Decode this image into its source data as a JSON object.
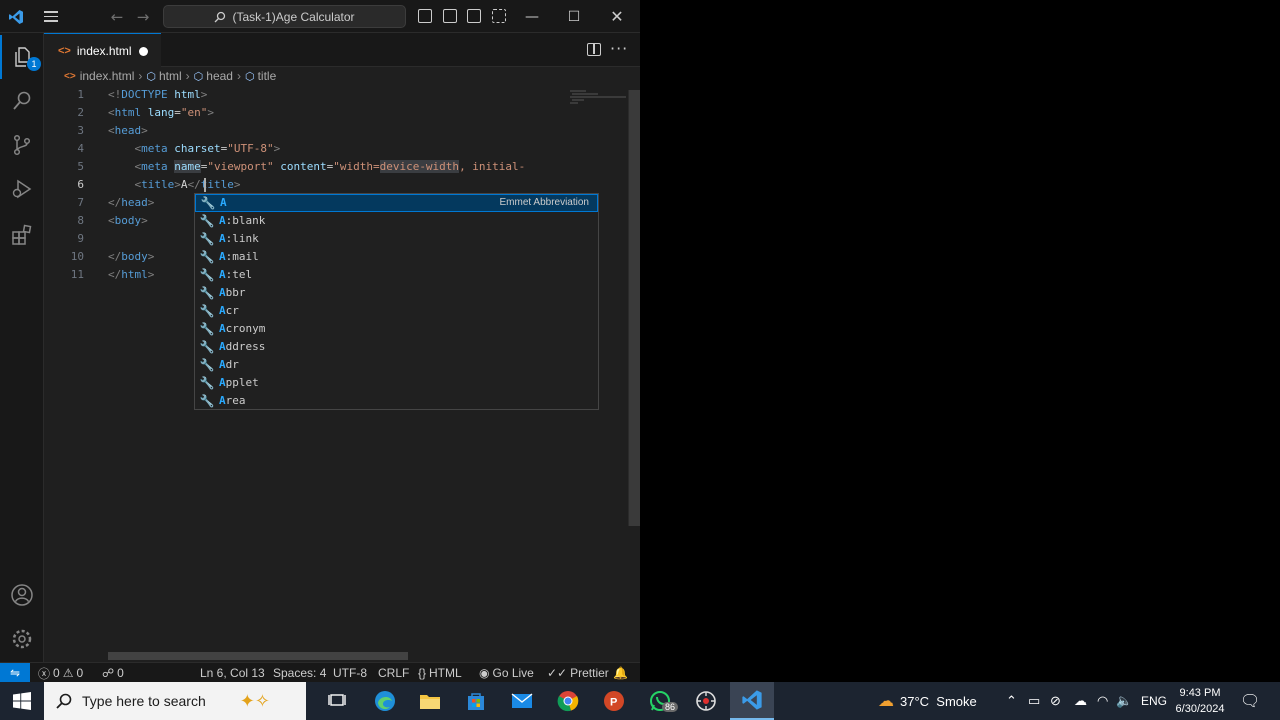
{
  "titlebar": {
    "command_center": "(Task-1)Age Calculator"
  },
  "activity": {
    "explorer_badge": "1"
  },
  "tab": {
    "label": "index.html"
  },
  "breadcrumb": {
    "items": [
      "index.html",
      "html",
      "head",
      "title"
    ]
  },
  "editor": {
    "line_numbers": [
      "1",
      "2",
      "3",
      "4",
      "5",
      "6",
      "7",
      "8",
      "9",
      "10",
      "11"
    ],
    "active_line": "6"
  },
  "suggest": {
    "detail": "Emmet Abbreviation",
    "items": [
      {
        "match": "A",
        "rest": ""
      },
      {
        "match": "A",
        "rest": ":blank"
      },
      {
        "match": "A",
        "rest": ":link"
      },
      {
        "match": "A",
        "rest": ":mail"
      },
      {
        "match": "A",
        "rest": ":tel"
      },
      {
        "match": "A",
        "rest": "bbr"
      },
      {
        "match": "A",
        "rest": "cr"
      },
      {
        "match": "A",
        "rest": "cronym"
      },
      {
        "match": "A",
        "rest": "ddress"
      },
      {
        "match": "A",
        "rest": "dr"
      },
      {
        "match": "A",
        "rest": "pplet"
      },
      {
        "match": "A",
        "rest": "rea"
      }
    ]
  },
  "statusbar": {
    "errors": "0",
    "warnings": "0",
    "ports": "0",
    "position": "Ln 6, Col 13",
    "spaces": "Spaces: 4",
    "encoding": "UTF-8",
    "eol": "CRLF",
    "language": "HTML",
    "golive": "Go Live",
    "prettier": "Prettier"
  },
  "taskbar": {
    "search_placeholder": "Type here to search",
    "whatsapp_badge": "86",
    "weather": "37°C  Smoke",
    "language": "ENG",
    "time": "9:43 PM",
    "date": "6/30/2024"
  },
  "colors": {
    "accent": "#0078d4",
    "editor_bg": "#1f1f1f",
    "taskbar_bg": "#1c2430"
  }
}
